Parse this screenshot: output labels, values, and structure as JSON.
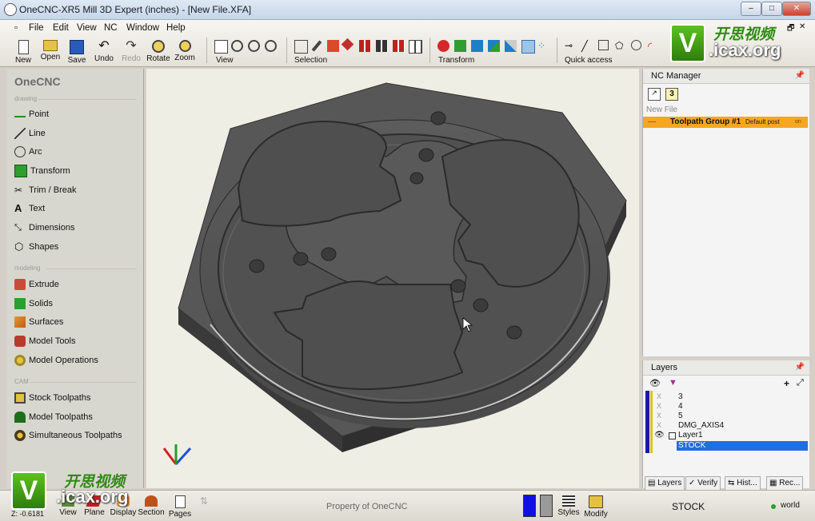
{
  "window": {
    "title": "OneCNC-XR5 Mill 3D Expert (inches) - [New File.XFA]"
  },
  "menu": [
    "File",
    "Edit",
    "View",
    "NC",
    "Window",
    "Help"
  ],
  "toolbar": {
    "buttons": [
      "New",
      "Open",
      "Save",
      "Undo",
      "Redo",
      "Rotate",
      "Zoom"
    ],
    "groups": {
      "view": "View",
      "selection": "Selection",
      "transform": "Transform",
      "quick": "Quick access"
    }
  },
  "left_panel": {
    "brand": "OneCNC",
    "sections": {
      "drawing": "drawing",
      "modeling": "modeling",
      "cam": "CAM"
    },
    "drawing_items": [
      "Point",
      "Line",
      "Arc",
      "Transform",
      "Trim / Break",
      "Text",
      "Dimensions",
      "Shapes"
    ],
    "modeling_items": [
      "Extrude",
      "Solids",
      "Surfaces",
      "Model Tools",
      "Model Operations"
    ],
    "cam_items": [
      "Stock Toolpaths",
      "Model Toolpaths",
      "Simultaneous Toolpaths"
    ]
  },
  "nc_manager": {
    "title": "NC Manager",
    "count_badge": "3",
    "new_file": "New File",
    "group_label": "Toolpath Group #1",
    "group_post": "Default post",
    "group_state": "on"
  },
  "layers": {
    "title": "Layers",
    "items": [
      "3",
      "4",
      "5",
      "DMG_AXIS4",
      "Layer1",
      "STOCK"
    ]
  },
  "bottom_tabs": [
    "Layers",
    "Verify",
    "Hist...",
    "Rec..."
  ],
  "status": {
    "coord": "Z: -0.6181",
    "buttons": [
      "View",
      "Plane",
      "Display",
      "Section",
      "Pages"
    ],
    "property": "Property of OneCNC",
    "styles": "Styles",
    "modify": "Modify",
    "stock": "STOCK",
    "world": "world"
  },
  "watermark": {
    "v": "V",
    "cn": "开思视频",
    "org": ".icax.org"
  },
  "colors": {
    "accent_orange": "#f5a623",
    "selection_blue": "#1f6fe0",
    "model_gray": "#5a5a5a"
  }
}
